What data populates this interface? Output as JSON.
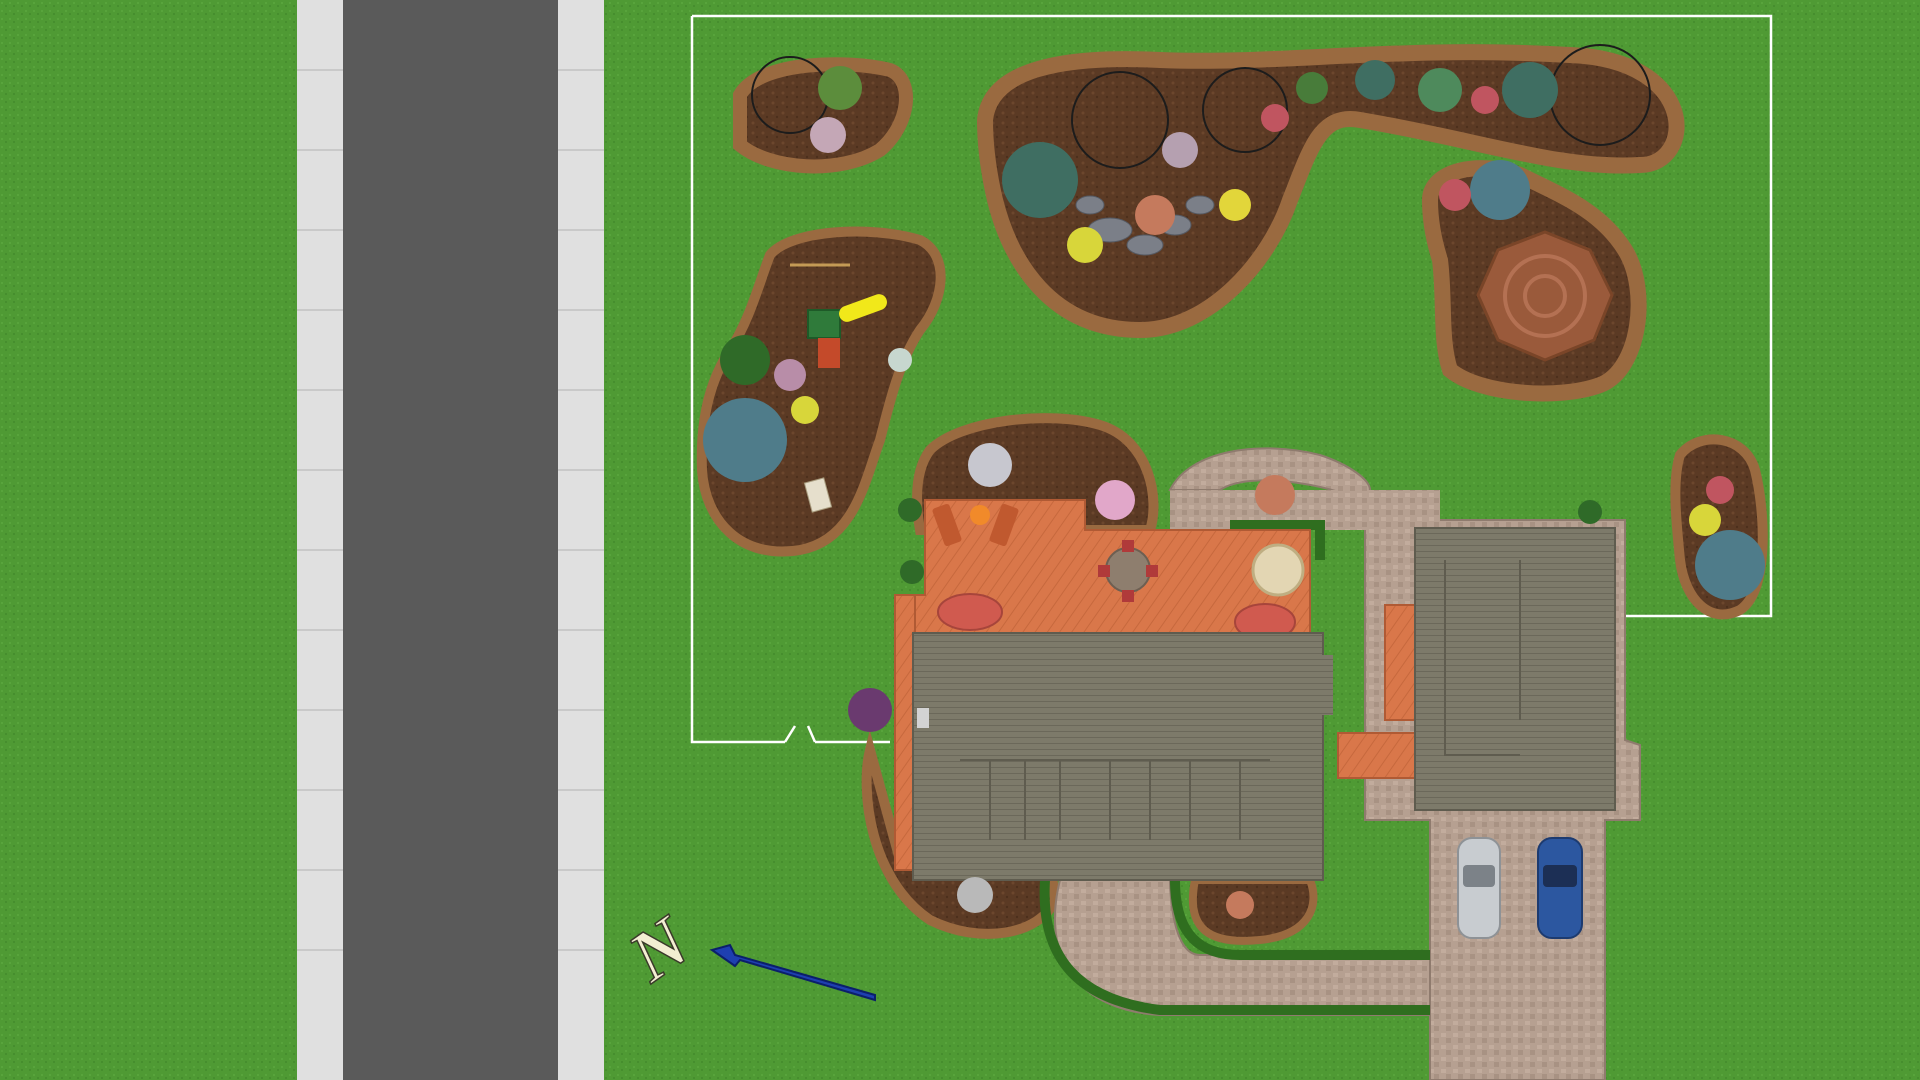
{
  "app": {
    "view": "landscape-plan-top-view"
  },
  "compass": {
    "label": "N"
  },
  "colors": {
    "lawn": "#4f9a34",
    "lawn_dark": "#3f8a28",
    "street": "#5a5a5a",
    "sidewalk": "#dcdcdc",
    "mulch": "#5b3a24",
    "mulch_edge": "#8a5a33",
    "deck": "#d9774a",
    "roof": "#7d7a6a",
    "paver": "#b6a091",
    "gazebo": "#9a5a3b",
    "hedge": "#3c7a2a",
    "fence": "#ffffff",
    "car_silver": "#c8ccd0",
    "car_blue": "#2c57a0",
    "arrow": "#1e3fb0",
    "compass_label": "#f3eed2"
  },
  "objects": [
    {
      "kind": "street",
      "name": "street"
    },
    {
      "kind": "sidewalk",
      "name": "sidewalk-left"
    },
    {
      "kind": "sidewalk",
      "name": "sidewalk-right"
    },
    {
      "kind": "fence",
      "name": "yard-fence"
    },
    {
      "kind": "bed",
      "name": "bed-northwest"
    },
    {
      "kind": "bed",
      "name": "bed-pond"
    },
    {
      "kind": "bed",
      "name": "bed-gazebo"
    },
    {
      "kind": "bed",
      "name": "bed-playground"
    },
    {
      "kind": "bed",
      "name": "bed-east"
    },
    {
      "kind": "house",
      "name": "house-roof"
    },
    {
      "kind": "garage",
      "name": "garage-roof"
    },
    {
      "kind": "deck",
      "name": "back-deck"
    },
    {
      "kind": "gazebo",
      "name": "gazebo"
    },
    {
      "kind": "driveway",
      "name": "driveway"
    },
    {
      "kind": "walkway",
      "name": "front-walkway"
    },
    {
      "kind": "car",
      "name": "car-silver"
    },
    {
      "kind": "car",
      "name": "car-blue"
    },
    {
      "kind": "play-set",
      "name": "play-set"
    }
  ]
}
